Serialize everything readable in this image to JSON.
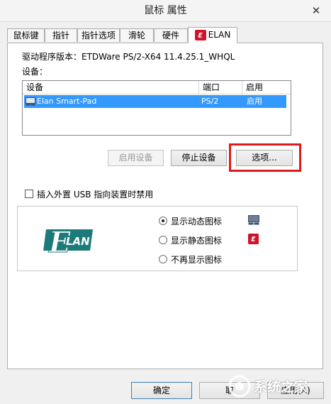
{
  "window": {
    "title": "鼠标 属性",
    "close_glyph": "✕"
  },
  "tabs": [
    {
      "label": "鼠标键"
    },
    {
      "label": "指针"
    },
    {
      "label": "指针选项"
    },
    {
      "label": "滑轮"
    },
    {
      "label": "硬件"
    },
    {
      "label": "ELAN",
      "icon": "elan-icon",
      "active": true
    }
  ],
  "elan_tab": {
    "driver_label": "驱动程序版本：",
    "driver_version": "ETDWare PS/2-X64 11.4.25.1_WHQL",
    "devices_label": "设备：",
    "columns": [
      "设备",
      "端口",
      "启用"
    ],
    "rows": [
      {
        "device": "Elan Smart-Pad",
        "port": "PS/2",
        "enabled": "启用",
        "selected": true
      }
    ],
    "buttons": {
      "enable": "启用设备",
      "stop": "停止设备",
      "options": "选项..."
    },
    "usb_disable_checkbox": {
      "label": "插入外置 USB 指向装置时禁用",
      "checked": false
    },
    "logo_text": "LAN",
    "logo_letter": "E",
    "icon_options": [
      {
        "label": "显示动态图标",
        "selected": true,
        "icon": "touchpad-icon"
      },
      {
        "label": "显示静态图标",
        "selected": false,
        "icon": "elan-icon"
      },
      {
        "label": "不再显示图标",
        "selected": false
      }
    ]
  },
  "footer": {
    "ok": "确定",
    "cancel": "取",
    "apply": "应用(A)"
  },
  "watermark": {
    "text": "系统之家"
  },
  "colors": {
    "selection": "#3399ff",
    "highlight_box": "#e01a1a",
    "elan_red": "#d0132a",
    "logo_teal": "#1d7a7a"
  }
}
